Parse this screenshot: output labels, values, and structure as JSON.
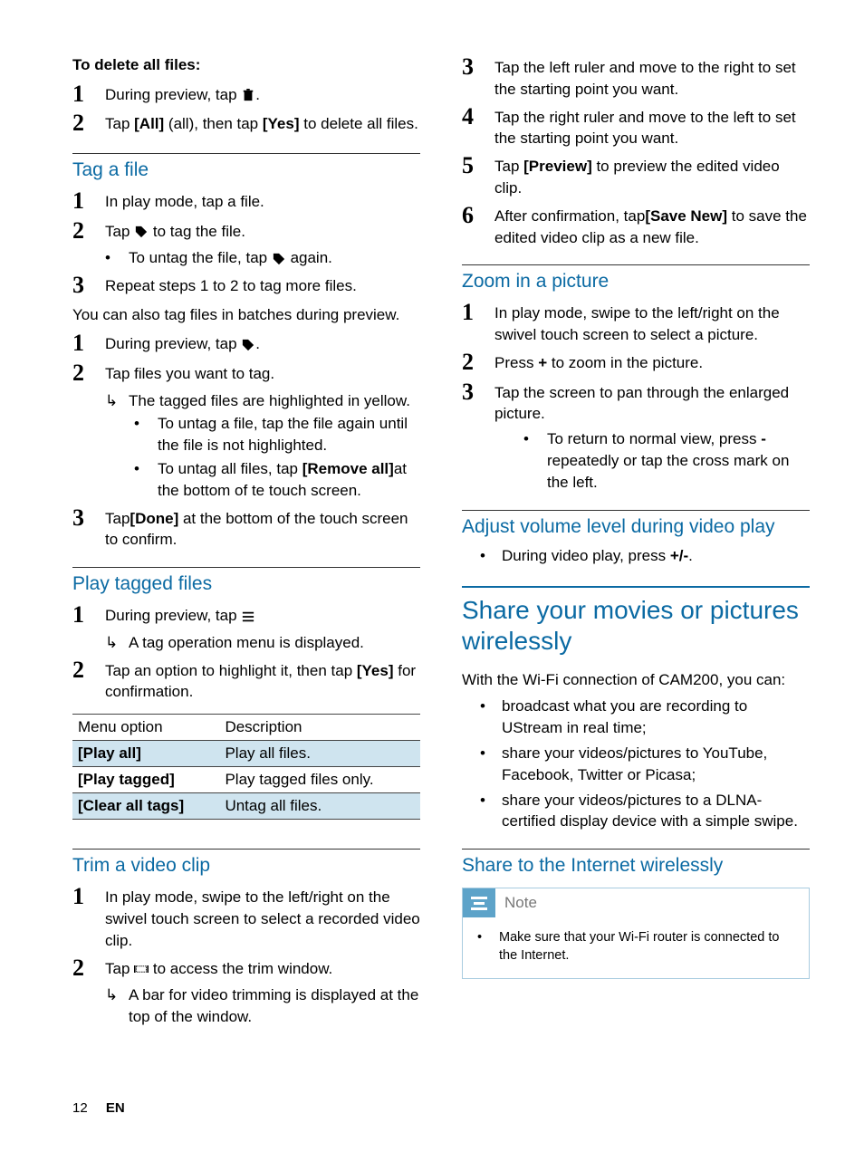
{
  "left": {
    "delete": {
      "heading": "To delete all files:",
      "step1_pre": "During preview, tap ",
      "step1_post": ".",
      "step2_a": "Tap ",
      "step2_all": "[All]",
      "step2_b": " (all), then tap ",
      "step2_yes": "[Yes]",
      "step2_c": " to delete all files."
    },
    "tag": {
      "h": "Tag a file",
      "s1": "In play mode, tap a file.",
      "s2_a": "Tap ",
      "s2_b": " to tag the file.",
      "s2_bul_a": "To untag the file, tap ",
      "s2_bul_b": " again.",
      "s3": "Repeat steps 1 to 2 to tag more files.",
      "also": "You can also tag files in batches during preview.",
      "b1_a": "During preview, tap ",
      "b1_b": ".",
      "b2": "Tap files you want to tag.",
      "b2_arrow": "The tagged files are highlighted in yellow.",
      "b2_bul1": "To untag a file, tap the file again until the file is not highlighted.",
      "b2_bul2_a": "To untag all files, tap ",
      "b2_bul2_remove": "[Remove all]",
      "b2_bul2_b": "at the bottom of te touch screen.",
      "b3_a": "Tap",
      "b3_done": "[Done]",
      "b3_b": " at the bottom of the touch screen to confirm."
    },
    "play": {
      "h": "Play tagged files",
      "s1_a": "During preview, tap ",
      "s1_arrow": "A tag operation menu is displayed.",
      "s2_a": "Tap an option to highlight it, then tap ",
      "s2_yes": "[Yes]",
      "s2_b": " for confirmation.",
      "th1": "Menu option",
      "th2": "Description",
      "rows": [
        {
          "opt": "[Play all]",
          "desc": "Play all files."
        },
        {
          "opt": "[Play tagged]",
          "desc": "Play tagged files only."
        },
        {
          "opt": "[Clear all tags]",
          "desc": "Untag all files."
        }
      ]
    },
    "trim": {
      "h": "Trim a video clip",
      "s1": "In play mode, swipe to the left/right on the swivel touch screen to select a recorded video clip.",
      "s2_a": "Tap ",
      "s2_b": " to access the trim window.",
      "s2_arrow": "A bar for video trimming is displayed at the top of the window."
    }
  },
  "right": {
    "trim_cont": {
      "s3": "Tap the left ruler and move to the right to set the starting point you want.",
      "s4": "Tap the right ruler and move to the left to set the starting point you want.",
      "s5_a": "Tap ",
      "s5_preview": "[Preview]",
      "s5_b": " to preview the edited video clip.",
      "s6_a": "After confirmation, tap",
      "s6_save": "[Save New]",
      "s6_b": " to save the edited video clip as a new file."
    },
    "zoom": {
      "h": "Zoom in a picture",
      "s1": "In play mode, swipe to the left/right on the swivel touch screen to select a picture.",
      "s2_a": "Press ",
      "s2_plus": "+",
      "s2_b": " to zoom in the picture.",
      "s3": "Tap the screen to pan through the enlarged picture.",
      "s3_bul_a": "To return to normal view, press ",
      "s3_bul_minus": "-",
      "s3_bul_b": " repeatedly or tap the cross mark on the left."
    },
    "volume": {
      "h": "Adjust volume level during video play",
      "bul_a": "During video play, press ",
      "bul_pm": "+/-",
      "bul_b": "."
    },
    "share": {
      "h1": "Share your movies or pictures wirelessly",
      "intro": "With the Wi-Fi connection of CAM200, you can:",
      "b1": "broadcast what you are recording to UStream in real time;",
      "b2": "share your videos/pictures to YouTube, Facebook, Twitter or Picasa;",
      "b3": "share your videos/pictures to a DLNA-certified display device with a simple swipe.",
      "h2": "Share to the Internet wirelessly",
      "note_title": "Note",
      "note_body": "Make sure that your Wi-Fi router is connected to the Internet."
    }
  },
  "footer": {
    "page": "12",
    "lang": "EN"
  }
}
